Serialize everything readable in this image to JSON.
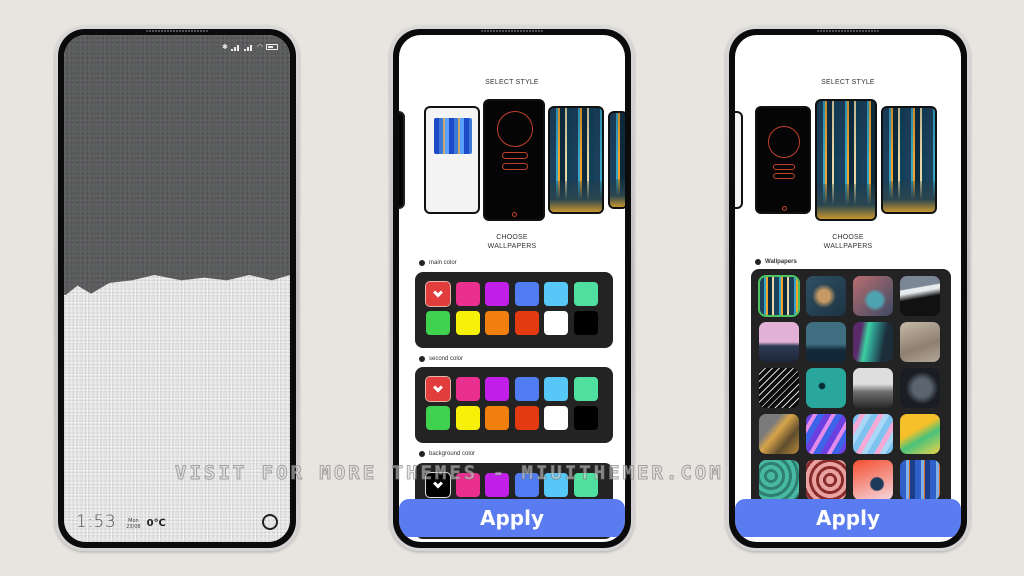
{
  "lockscreen": {
    "time": "1:53",
    "day": "Mon",
    "date": "23/08",
    "temperature": "0℃",
    "status_icons": [
      "bluetooth-icon",
      "signal-icon",
      "signal-icon",
      "wifi-icon",
      "battery-icon"
    ]
  },
  "style_picker": {
    "title": "SELECT STYLE",
    "styles": [
      "minimal-white",
      "neon-outline-black",
      "city-night",
      "city-night-alt"
    ]
  },
  "wallpapers_heading": {
    "line1": "CHOOSE",
    "line2": "WALLPAPERS"
  },
  "color_sections": [
    {
      "label": "main color",
      "selected_index": 0,
      "colors": [
        "#e23d3d",
        "#ea2f8e",
        "#c11ee8",
        "#4f7cf0",
        "#56c7f6",
        "#4fe0a0",
        "#3fd24f",
        "#f7f10a",
        "#f17f0d",
        "#e43a12",
        "#ffffff",
        "#000000"
      ]
    },
    {
      "label": "second color",
      "selected_index": 0,
      "colors": [
        "#e23d3d",
        "#ea2f8e",
        "#c11ee8",
        "#4f7cf0",
        "#56c7f6",
        "#4fe0a0",
        "#3fd24f",
        "#f7f10a",
        "#f17f0d",
        "#e43a12",
        "#ffffff",
        "#000000"
      ]
    },
    {
      "label": "background color",
      "selected_index": 0,
      "colors": [
        "#000000",
        "#ea2f8e",
        "#c11ee8",
        "#4f7cf0",
        "#56c7f6",
        "#4fe0a0"
      ]
    }
  ],
  "wallpapers": {
    "label": "Wallpapers",
    "selected_index": 0,
    "items": [
      "city-night",
      "aerial-forest",
      "aerial-lake",
      "snowy-mountain",
      "pink-dusk-hills",
      "starry-treeline",
      "aurora",
      "beige-clouds",
      "black-waves",
      "teal-water-kayak",
      "misty-forest",
      "grey-owl",
      "golden-abstract",
      "purple-fluid",
      "pastel-fluid",
      "yellow-green-fluid",
      "teal-marble",
      "red-marble",
      "orange-splash",
      "blue-abstract"
    ]
  },
  "apply_label": "Apply",
  "watermark": "VISIT FOR MORE THEMES - MIUITHEMER.COM"
}
